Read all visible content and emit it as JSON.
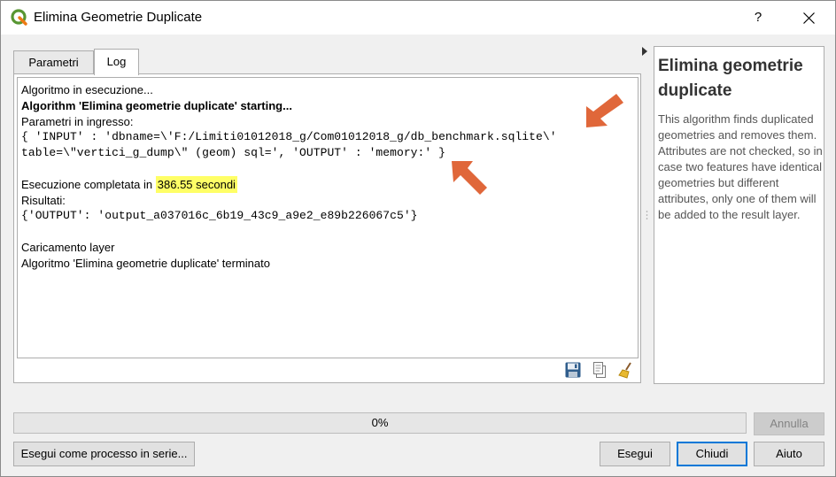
{
  "window": {
    "title": "Elimina Geometrie Duplicate",
    "help_glyph": "?",
    "close_icon": "close-icon",
    "logo_icon": "qgis-logo-icon"
  },
  "tabs": [
    {
      "label": "Parametri",
      "active": false
    },
    {
      "label": "Log",
      "active": true
    }
  ],
  "log": {
    "lines": [
      {
        "text": "Algoritmo in esecuzione...",
        "style": "normal"
      },
      {
        "text": "Algorithm 'Elimina geometrie duplicate' starting...",
        "style": "bold"
      },
      {
        "text": "Parametri in ingresso:",
        "style": "normal"
      },
      {
        "text": "{ 'INPUT' : 'dbname=\\'F:/Limiti01012018_g/Com01012018_g/db_benchmark.sqlite\\'",
        "style": "mono"
      },
      {
        "text": "table=\\\"vertici_g_dump\\\" (geom) sql=', 'OUTPUT' : 'memory:' }",
        "style": "mono"
      },
      {
        "text": "",
        "style": "normal"
      },
      {
        "text": "Esecuzione completata in ",
        "style": "normal",
        "highlight": "386.55 secondi"
      },
      {
        "text": "Risultati:",
        "style": "normal"
      },
      {
        "text": "{'OUTPUT': 'output_a037016c_6b19_43c9_a9e2_e89b226067c5'}",
        "style": "mono"
      },
      {
        "text": "",
        "style": "normal"
      },
      {
        "text": "Caricamento layer",
        "style": "normal"
      },
      {
        "text": "Algoritmo 'Elimina geometrie duplicate' terminato",
        "style": "normal"
      }
    ],
    "tools": [
      "save-log-icon",
      "copy-log-icon",
      "clear-log-icon"
    ],
    "highlight_color": "#ffff66",
    "annotation_arrow_color": "#e0673a"
  },
  "help": {
    "title": "Elimina geometrie duplicate",
    "description": "This algorithm finds duplicated geometries and removes them. Attributes are not checked, so in case two features have identical geometries but different attributes, only one of them will be added to the result layer."
  },
  "progress": {
    "value": 0,
    "label": "0%",
    "fill_color": "#06b025"
  },
  "buttons": {
    "cancel": "Annulla",
    "batch": "Esegui come processo in serie...",
    "run": "Esegui",
    "close": "Chiudi",
    "help": "Aiuto"
  }
}
